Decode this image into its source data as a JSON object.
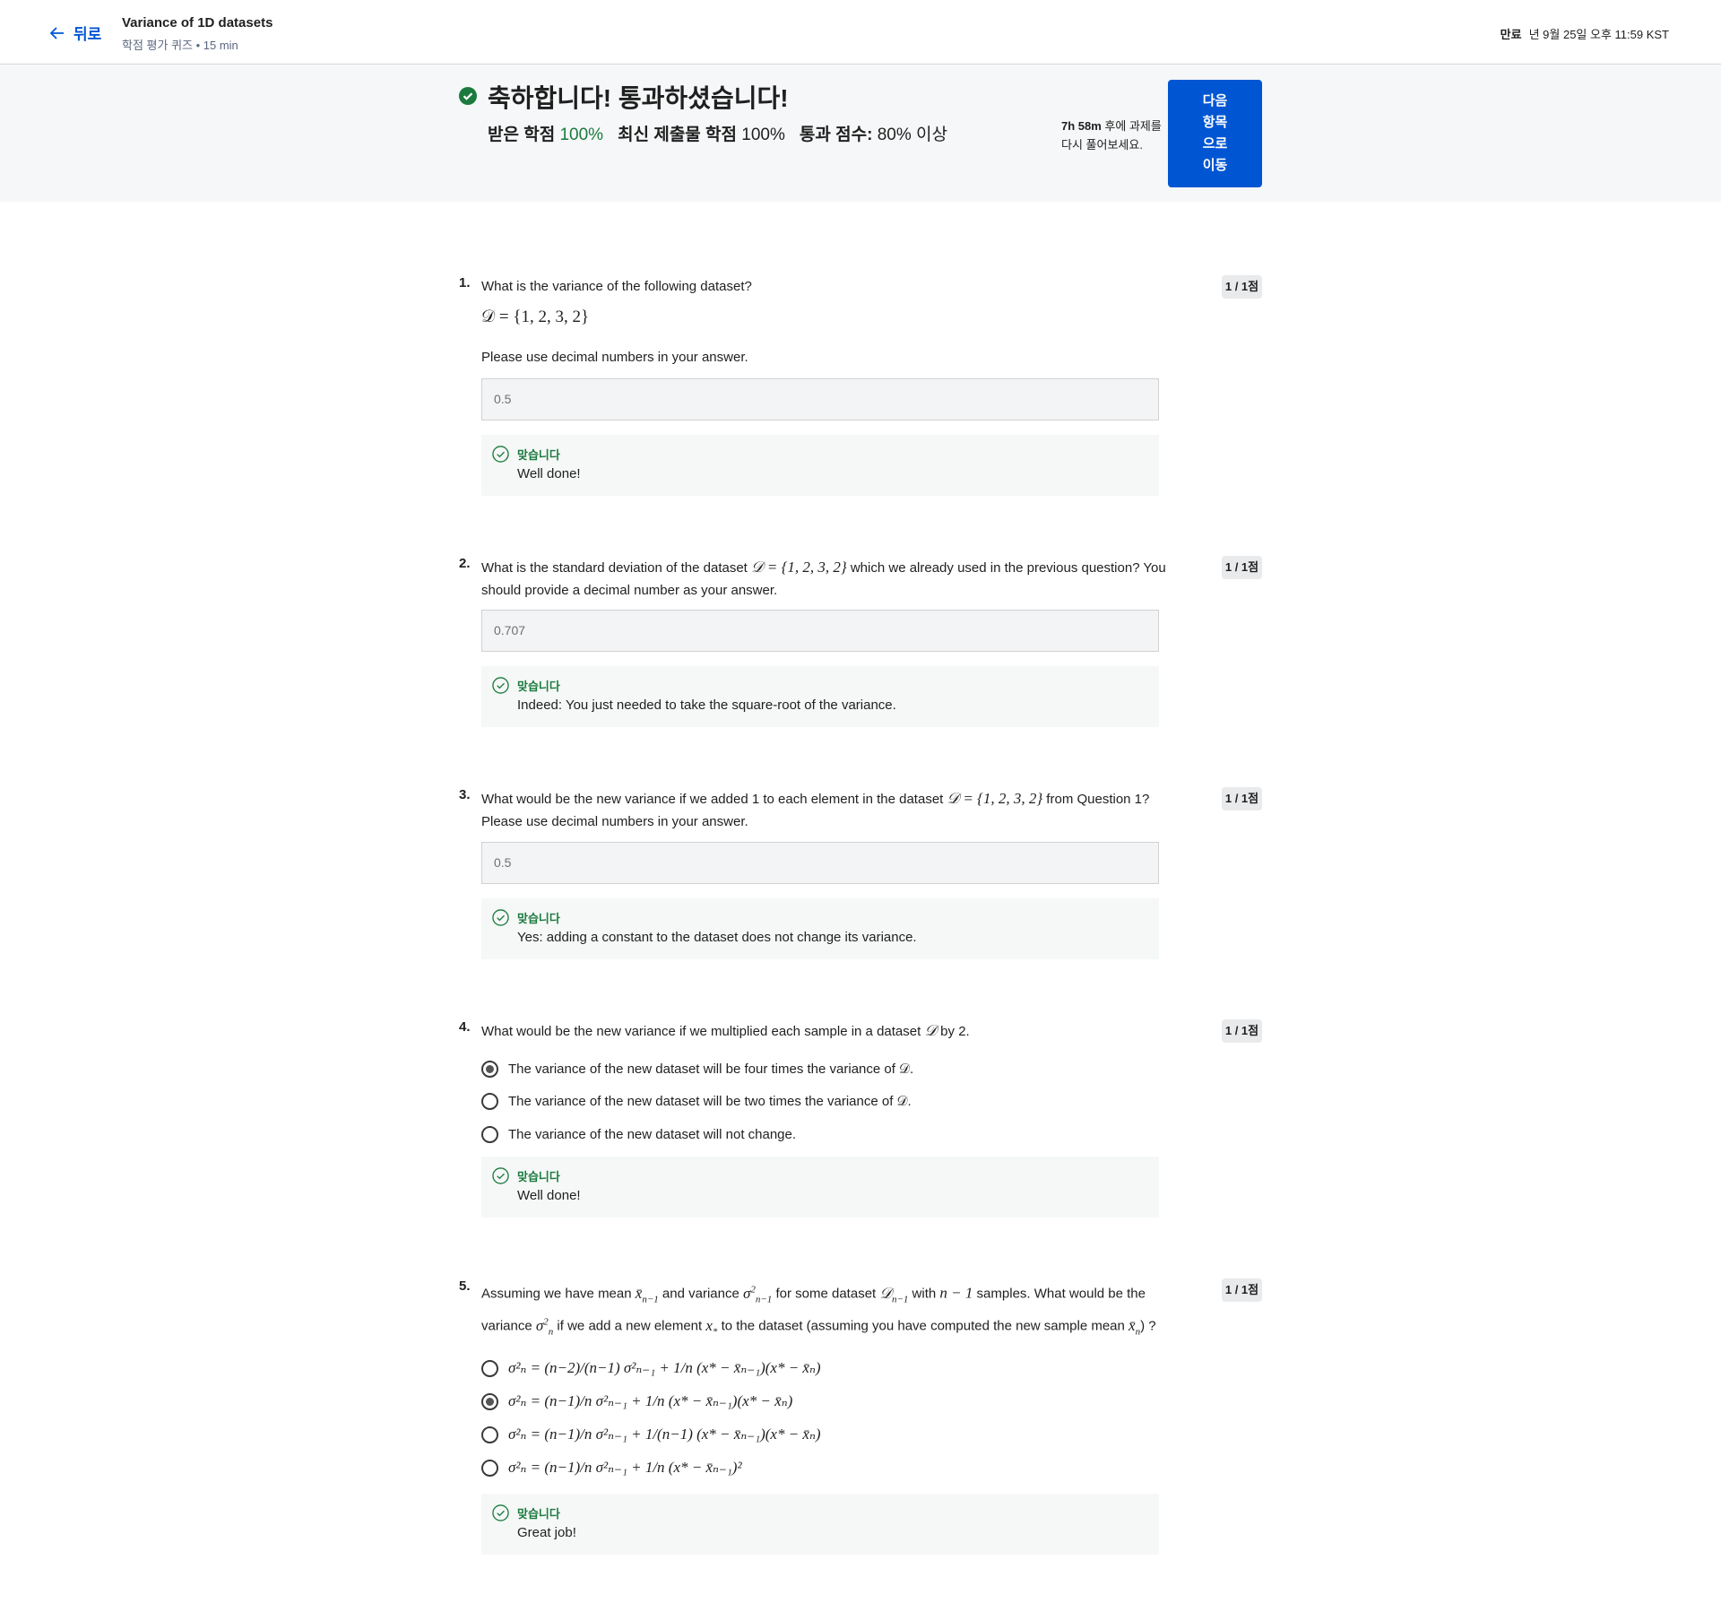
{
  "header": {
    "back_label": "뒤로",
    "quiz_title": "Variance of 1D datasets",
    "quiz_subtitle": "학점 평가 퀴즈 • 15 min",
    "due_label": "만료",
    "due_date": "년 9월 25일 오후 11:59 KST"
  },
  "banner": {
    "title": "축하합니다! 통과하셨습니다!",
    "received_label": "받은 학점",
    "received_value": "100%",
    "latest_label": "최신 제출물 학점",
    "latest_value": "100%",
    "pass_label": "통과 점수:",
    "pass_value": "80% 이상",
    "retry_time": "7h 58m",
    "retry_text_1": " 후에 과제를",
    "retry_text_2": "다시 풀어보세요.",
    "next_button": [
      "다음",
      "항목",
      "으로",
      "이동"
    ]
  },
  "feedback_label": "맞습니다",
  "questions": [
    {
      "number": "1.",
      "text": "What is the variance of the following dataset?",
      "formula": "𝒟 = {1, 2, 3, 2}",
      "note": "Please use decimal numbers in your answer.",
      "answer": "0.5",
      "score": "1 / 1점",
      "feedback": "Well done!"
    },
    {
      "number": "2.",
      "text_a": "What is the standard deviation of the dataset ",
      "formula": "𝒟 = {1, 2, 3, 2}",
      "text_b": " which we already used in the previous question? You should provide a decimal number as your answer.",
      "answer": "0.707",
      "score": "1 / 1점",
      "feedback": "Indeed: You just needed to take the square-root of the variance."
    },
    {
      "number": "3.",
      "text_a": "What would be the new variance if we added 1 to each element in the dataset ",
      "formula": "𝒟 = {1, 2, 3, 2}",
      "text_b": " from Question 1? Please use decimal numbers in your answer.",
      "answer": "0.5",
      "score": "1 / 1점",
      "feedback": "Yes: adding a constant to the dataset does not change its variance."
    },
    {
      "number": "4.",
      "text_a": "What would be the new variance if we multiplied each sample in a dataset ",
      "symbol": "𝒟",
      "text_b": " by 2.",
      "options": [
        "The variance of the new dataset will be four times the variance of 𝒟.",
        "The variance of the new dataset will be two times the variance of 𝒟.",
        "The variance of the new dataset will not change."
      ],
      "selected_index": 0,
      "score": "1 / 1점",
      "feedback": "Well done!"
    },
    {
      "number": "5.",
      "text_a": "Assuming we have mean ",
      "m1": "x̄",
      "m1_sub": "n−1",
      "text_b": " and variance ",
      "m2": "σ",
      "m2_sub": "n−1",
      "text_c": " for some dataset ",
      "m3": "𝒟",
      "m3_sub": "n−1",
      "text_d": " with ",
      "m4": "n − 1",
      "text_e": " samples. What would be the  variance ",
      "m5_sub": "n",
      "text_f": " if we add a new element ",
      "m6": "x",
      "m6_sub": "*",
      "text_g": " to the dataset (assuming you have computed the new sample mean ",
      "m7": "x̄",
      "m7_sub": "n",
      "text_h": ") ?",
      "options": [
        "σ²ₙ = (n−2)/(n−1) σ²ₙ₋₁ + 1/n (x* − x̄ₙ₋₁)(x* − x̄ₙ)",
        "σ²ₙ = (n−1)/n σ²ₙ₋₁ + 1/n (x* − x̄ₙ₋₁)(x* − x̄ₙ)",
        "σ²ₙ = (n−1)/n σ²ₙ₋₁ + 1/(n−1) (x* − x̄ₙ₋₁)(x* − x̄ₙ)",
        "σ²ₙ = (n−1)/n σ²ₙ₋₁ + 1/n (x* − x̄ₙ₋₁)²"
      ],
      "selected_index": 1,
      "score": "1 / 1점",
      "feedback": "Great job!"
    }
  ]
}
